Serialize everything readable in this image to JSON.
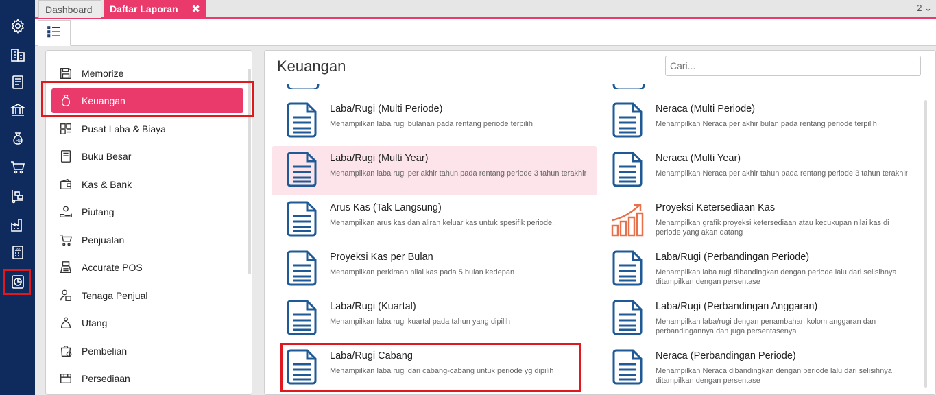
{
  "tabs": {
    "dashboard": "Dashboard",
    "report": "Daftar Laporan",
    "close_icon": "✖",
    "count": "2 ⌄"
  },
  "colors": {
    "nav": "#0f2a5c",
    "accent": "#ea3a6b",
    "report_icon": "#1f5a96",
    "chart_icon": "#e8704a",
    "highlight_box": "#e0191e"
  },
  "nav_icons": [
    "gear-icon",
    "building-icon",
    "ledger-icon",
    "bank-icon",
    "money-bag-icon",
    "cart-icon",
    "hand-truck-icon",
    "factory-icon",
    "tax-icon",
    "report-icon"
  ],
  "categories": [
    {
      "label": "Memorize",
      "icon": "save-icon"
    },
    {
      "label": "Keuangan",
      "icon": "money-bag-icon"
    },
    {
      "label": "Pusat Laba & Biaya",
      "icon": "grid-icon"
    },
    {
      "label": "Buku Besar",
      "icon": "book-icon"
    },
    {
      "label": "Kas & Bank",
      "icon": "wallet-icon"
    },
    {
      "label": "Piutang",
      "icon": "hand-money-icon"
    },
    {
      "label": "Penjualan",
      "icon": "cart-icon"
    },
    {
      "label": "Accurate POS",
      "icon": "pos-icon"
    },
    {
      "label": "Tenaga Penjual",
      "icon": "salesperson-icon"
    },
    {
      "label": "Utang",
      "icon": "debt-icon"
    },
    {
      "label": "Pembelian",
      "icon": "purchase-icon"
    },
    {
      "label": "Persediaan",
      "icon": "inventory-icon"
    }
  ],
  "reports": {
    "title": "Keuangan",
    "search_placeholder": "Cari...",
    "items": [
      {
        "name": "Laba/Rugi (Multi Periode)",
        "desc": "Menampilkan laba rugi bulanan pada rentang periode terpilih"
      },
      {
        "name": "Neraca (Multi Periode)",
        "desc": "Menampilkan Neraca per akhir bulan pada rentang periode terpilih"
      },
      {
        "name": "Laba/Rugi (Multi Year)",
        "desc": "Menampilkan laba rugi per akhir tahun pada rentang periode 3 tahun terakhir"
      },
      {
        "name": "Neraca (Multi Year)",
        "desc": "Menampilkan Neraca per akhir tahun pada rentang periode 3 tahun terakhir"
      },
      {
        "name": "Arus Kas (Tak Langsung)",
        "desc": "Menampilkan arus kas dan aliran keluar kas untuk spesifik periode."
      },
      {
        "name": "Proyeksi Ketersediaan Kas",
        "desc": "Menampilkan grafik proyeksi ketersediaan atau kecukupan nilai kas di periode yang akan datang"
      },
      {
        "name": "Proyeksi Kas per Bulan",
        "desc": "Menampilkan perkiraan nilai kas pada 5 bulan kedepan"
      },
      {
        "name": "Laba/Rugi (Perbandingan Periode)",
        "desc": "Menampilkan laba rugi dibandingkan dengan periode lalu dari selisihnya ditampilkan dengan persentase"
      },
      {
        "name": "Laba/Rugi (Kuartal)",
        "desc": "Menampilkan laba rugi kuartal pada tahun yang dipilih"
      },
      {
        "name": "Laba/Rugi (Perbandingan Anggaran)",
        "desc": "Menampilkan laba/rugi dengan penambahan kolom anggaran dan perbandingannya dan juga persentasenya"
      },
      {
        "name": "Laba/Rugi Cabang",
        "desc": "Menampilkan laba rugi dari cabang-cabang untuk periode yg dipilih"
      },
      {
        "name": "Neraca (Perbandingan Periode)",
        "desc": "Menampilkan Neraca dibandingkan dengan periode lalu dari selisihnya ditampilkan dengan persentase"
      }
    ]
  }
}
